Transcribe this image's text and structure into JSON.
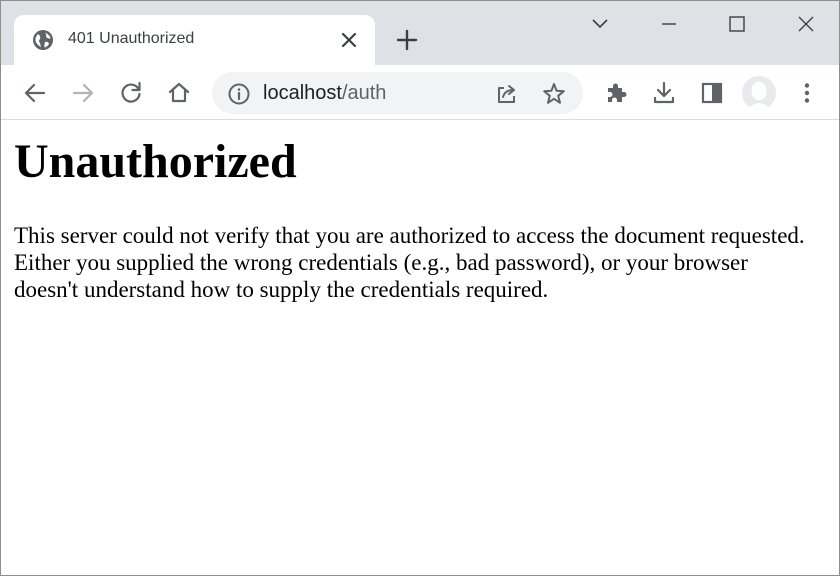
{
  "tab": {
    "title": "401 Unauthorized",
    "favicon": "globe-icon"
  },
  "toolbar": {
    "back_icon": "arrow-left-icon",
    "forward_icon": "arrow-right-icon",
    "reload_icon": "reload-icon",
    "home_icon": "home-icon"
  },
  "omnibox": {
    "host": "localhost",
    "path": "/auth"
  },
  "page": {
    "heading": "Unauthorized",
    "message": "This server could not verify that you are authorized to access the document requested. Either you supplied the wrong credentials (e.g., bad password), or your browser doesn't understand how to supply the credentials required."
  },
  "colors": {
    "tabstrip": "#dee1e6",
    "omnibox": "#f1f3f4",
    "icon": "#5f6368",
    "disabled_icon": "#b0b3b8"
  }
}
